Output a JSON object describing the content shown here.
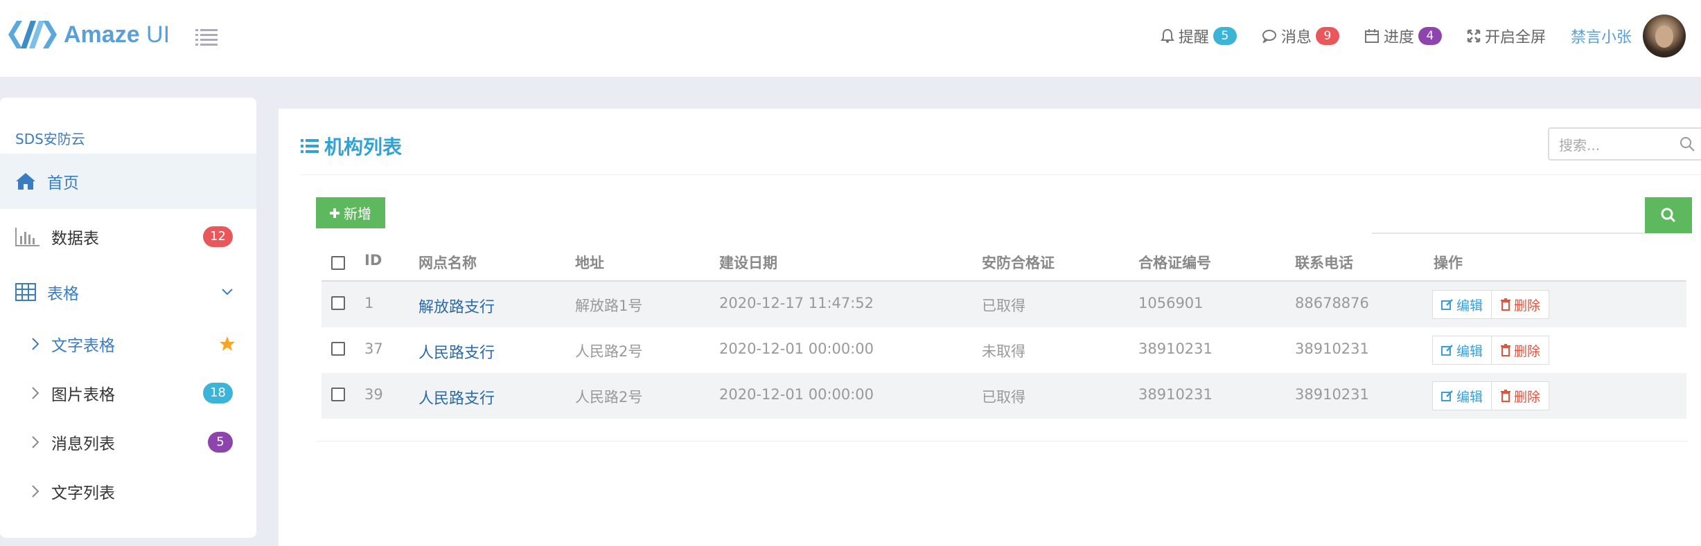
{
  "header": {
    "logo_text_bold": "Amaze",
    "logo_text_light": " UI",
    "nav": [
      {
        "label": "提醒",
        "badge": "5",
        "badge_color": "#3bb4d8"
      },
      {
        "label": "消息",
        "badge": "9",
        "badge_color": "#e9575a"
      },
      {
        "label": "进度",
        "badge": "4",
        "badge_color": "#8e44ad"
      },
      {
        "label": "开启全屏"
      }
    ],
    "user_name": "禁言小张"
  },
  "sidebar": {
    "title": "SDS安防云",
    "items": [
      {
        "label": "首页",
        "icon": "home-icon"
      },
      {
        "label": "数据表",
        "icon": "bar-chart-icon",
        "badge": "12",
        "badge_color": "#e9575a"
      },
      {
        "label": "表格",
        "icon": "table-icon"
      },
      {
        "label": "文字表格",
        "icon": "chevron-right-icon"
      },
      {
        "label": "图片表格",
        "icon": "chevron-right-icon",
        "badge": "18",
        "badge_color": "#3bb4d8"
      },
      {
        "label": "消息列表",
        "icon": "chevron-right-icon",
        "badge": "5",
        "badge_color": "#8e44ad"
      },
      {
        "label": "文字列表",
        "icon": "chevron-right-icon"
      }
    ]
  },
  "main": {
    "title": "机构列表",
    "search_placeholder": "搜索...",
    "add_button": "新增",
    "table": {
      "headers": [
        "ID",
        "网点名称",
        "地址",
        "建设日期",
        "安防合格证",
        "合格证编号",
        "联系电话",
        "操作"
      ],
      "rows": [
        {
          "id": "1",
          "name": "解放路支行",
          "address": "解放路1号",
          "date": "2020-12-17 11:47:52",
          "cert": "已取得",
          "cert_no": "1056901",
          "phone": "88678876"
        },
        {
          "id": "37",
          "name": "人民路支行",
          "address": "人民路2号",
          "date": "2020-12-01 00:00:00",
          "cert": "未取得",
          "cert_no": "38910231",
          "phone": "38910231"
        },
        {
          "id": "39",
          "name": "人民路支行",
          "address": "人民路2号",
          "date": "2020-12-01 00:00:00",
          "cert": "已取得",
          "cert_no": "38910231",
          "phone": "38910231"
        }
      ],
      "edit_label": "编辑",
      "delete_label": "删除"
    }
  }
}
